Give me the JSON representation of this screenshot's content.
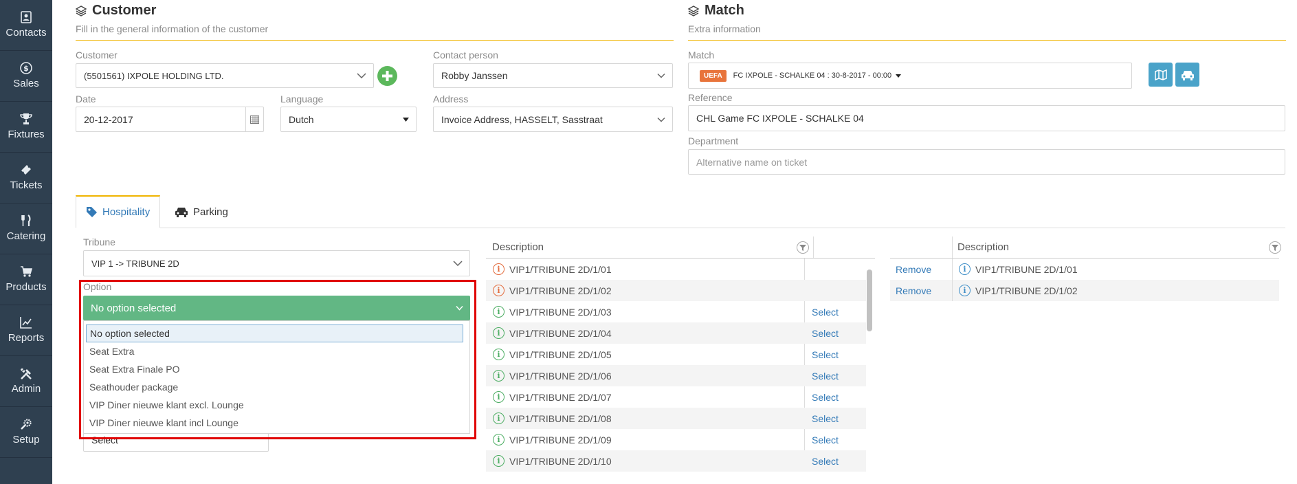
{
  "sidebar": [
    {
      "label": "Contacts",
      "icon": "contacts-icon"
    },
    {
      "label": "Sales",
      "icon": "dollar-icon"
    },
    {
      "label": "Fixtures",
      "icon": "trophy-icon"
    },
    {
      "label": "Tickets",
      "icon": "ticket-icon"
    },
    {
      "label": "Catering",
      "icon": "cutlery-icon"
    },
    {
      "label": "Products",
      "icon": "cart-icon"
    },
    {
      "label": "Reports",
      "icon": "chart-icon"
    },
    {
      "label": "Admin",
      "icon": "tools-icon"
    },
    {
      "label": "Setup",
      "icon": "wrench-gear-icon"
    }
  ],
  "customer_section": {
    "title": "Customer",
    "subtitle": "Fill in the general information of the customer",
    "customer_label": "Customer",
    "customer_value": "(5501561) IXPOLE HOLDING LTD.",
    "contact_label": "Contact person",
    "contact_value": "Robby Janssen",
    "date_label": "Date",
    "date_value": "20-12-2017",
    "language_label": "Language",
    "language_value": "Dutch",
    "address_label": "Address",
    "address_value": "Invoice Address, HASSELT, Sasstraat"
  },
  "match_section": {
    "title": "Match",
    "subtitle": "Extra information",
    "match_label": "Match",
    "match_badge": "UEFA",
    "match_value": "FC IXPOLE - SCHALKE 04 : 30-8-2017 - 00:00",
    "reference_label": "Reference",
    "reference_value": "CHL Game FC IXPOLE - SCHALKE 04",
    "department_label": "Department",
    "department_placeholder": "Alternative name on ticket"
  },
  "tabs": [
    {
      "label": "Hospitality",
      "active": true
    },
    {
      "label": "Parking",
      "active": false
    }
  ],
  "hospitality": {
    "tribune_label": "Tribune",
    "tribune_value": "VIP 1 -> TRIBUNE 2D",
    "option_label": "Option",
    "option_selected": "No option selected",
    "options": [
      "No option selected",
      "Seat Extra",
      "Seat Extra Finale PO",
      "Seathouder package",
      "VIP Diner nieuwe klant excl. Lounge",
      "VIP Diner nieuwe klant incl Lounge"
    ],
    "hidden_select": "Select"
  },
  "available_table": {
    "header": "Description",
    "rows": [
      {
        "desc": "VIP1/TRIBUNE 2D/1/01",
        "status": "red",
        "action": ""
      },
      {
        "desc": "VIP1/TRIBUNE 2D/1/02",
        "status": "red",
        "action": ""
      },
      {
        "desc": "VIP1/TRIBUNE 2D/1/03",
        "status": "green",
        "action": "Select"
      },
      {
        "desc": "VIP1/TRIBUNE 2D/1/04",
        "status": "green",
        "action": "Select"
      },
      {
        "desc": "VIP1/TRIBUNE 2D/1/05",
        "status": "green",
        "action": "Select"
      },
      {
        "desc": "VIP1/TRIBUNE 2D/1/06",
        "status": "green",
        "action": "Select"
      },
      {
        "desc": "VIP1/TRIBUNE 2D/1/07",
        "status": "green",
        "action": "Select"
      },
      {
        "desc": "VIP1/TRIBUNE 2D/1/08",
        "status": "green",
        "action": "Select"
      },
      {
        "desc": "VIP1/TRIBUNE 2D/1/09",
        "status": "green",
        "action": "Select"
      },
      {
        "desc": "VIP1/TRIBUNE 2D/1/10",
        "status": "green",
        "action": "Select"
      }
    ]
  },
  "selected_table": {
    "header": "Description",
    "rows": [
      {
        "action": "Remove",
        "desc": "VIP1/TRIBUNE 2D/1/01"
      },
      {
        "action": "Remove",
        "desc": "VIP1/TRIBUNE 2D/1/02"
      }
    ]
  },
  "colors": {
    "sidebar": "#2f4050",
    "accent_line": "#f0b400",
    "option_selected": "#62b784",
    "highlight_border": "#e00000",
    "link": "#337ab7",
    "badge": "#e8743b",
    "action_button": "#4aa3c9"
  }
}
